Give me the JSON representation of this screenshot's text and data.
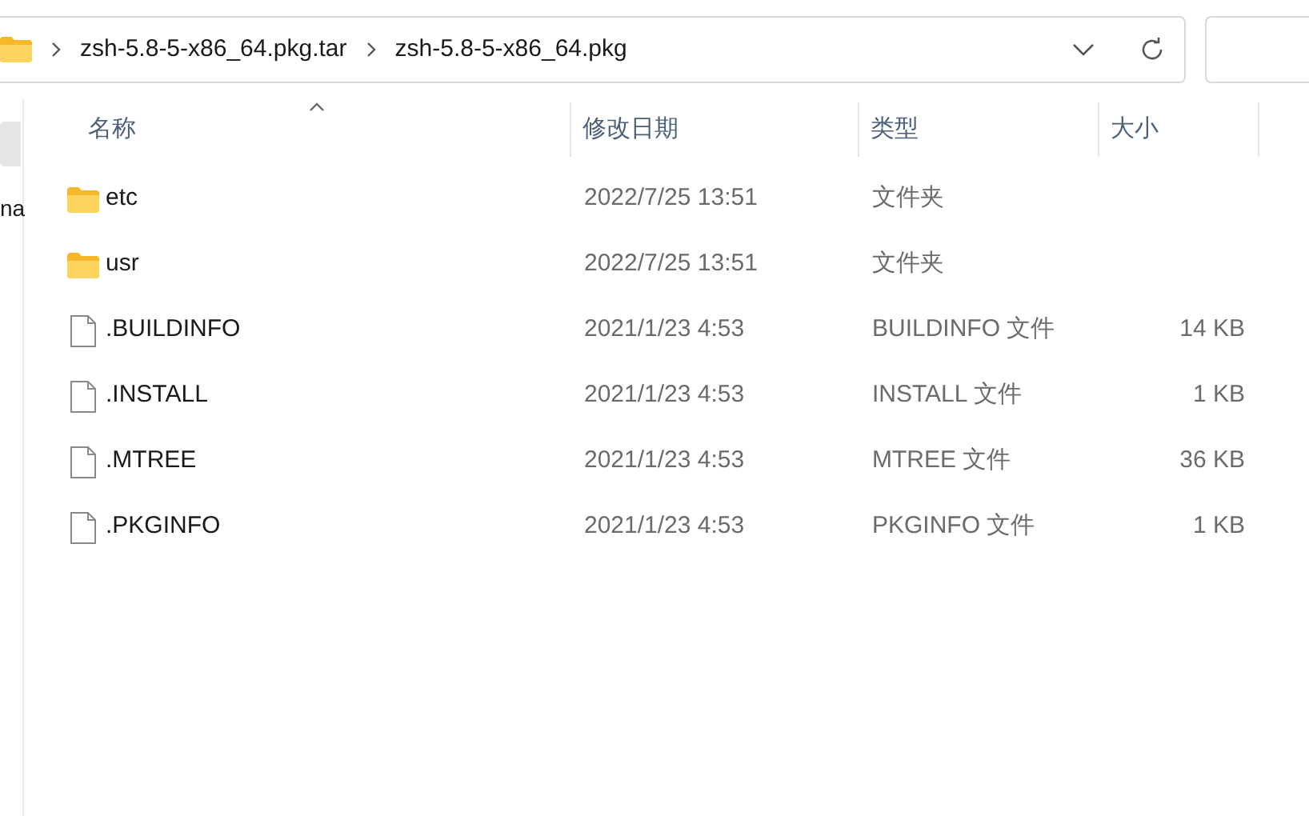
{
  "address_bar": {
    "breadcrumbs": [
      "zsh-5.8-5-x86_64.pkg.tar",
      "zsh-5.8-5-x86_64.pkg"
    ]
  },
  "sidebar": {
    "items": [
      {
        "label": "na"
      }
    ]
  },
  "table": {
    "columns": [
      {
        "label": "名称",
        "sorted": true
      },
      {
        "label": "修改日期",
        "sorted": false
      },
      {
        "label": "类型",
        "sorted": false
      },
      {
        "label": "大小",
        "sorted": false
      }
    ],
    "rows": [
      {
        "kind": "folder",
        "name": "etc",
        "date": "2022/7/25 13:51",
        "type": "文件夹"
      },
      {
        "kind": "folder",
        "name": "usr",
        "date": "2022/7/25 13:51",
        "type": "文件夹"
      },
      {
        "kind": "file",
        "name": ".BUILDINFO",
        "date": "2021/1/23 4:53",
        "type": "BUILDINFO 文件",
        "size": "14 KB"
      },
      {
        "kind": "file",
        "name": ".INSTALL",
        "date": "2021/1/23 4:53",
        "type": "INSTALL 文件",
        "size": "1 KB"
      },
      {
        "kind": "file",
        "name": ".MTREE",
        "date": "2021/1/23 4:53",
        "type": "MTREE 文件",
        "size": "36 KB"
      },
      {
        "kind": "file",
        "name": ".PKGINFO",
        "date": "2021/1/23 4:53",
        "type": "PKGINFO 文件",
        "size": "1 KB"
      }
    ]
  }
}
